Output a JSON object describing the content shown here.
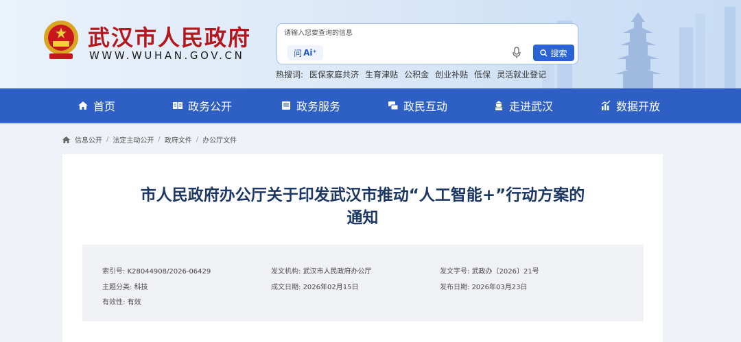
{
  "header": {
    "site_title": "武汉市人民政府",
    "site_url": "WWW.WUHAN.GOV.CN",
    "emblem_icon": "national-emblem-icon",
    "search": {
      "placeholder": "请输入您要查询的信息",
      "ai_label_prefix": "问",
      "ai_label_brand": "Ai⁺",
      "button_label": "搜索"
    },
    "hot_search": {
      "label": "热搜词:",
      "terms": [
        "医保家庭共济",
        "生育津贴",
        "公积金",
        "创业补贴",
        "低保",
        "灵活就业登记"
      ]
    }
  },
  "nav": {
    "items": [
      {
        "label": "首页",
        "icon": "home-icon"
      },
      {
        "label": "政务公开",
        "icon": "open-book-icon"
      },
      {
        "label": "政务服务",
        "icon": "briefcase-icon"
      },
      {
        "label": "政民互动",
        "icon": "chat-icon"
      },
      {
        "label": "走进武汉",
        "icon": "landmark-icon"
      },
      {
        "label": "数据开放",
        "icon": "bar-chart-icon"
      }
    ],
    "accent": "#2e5fc4"
  },
  "breadcrumb": [
    "信息公开",
    "法定主动公开",
    "政府文件",
    "办公厅文件"
  ],
  "document": {
    "title_line1": "市人民政府办公厅关于印发武汉市推动“人工智能+”行动方案的",
    "title_line2": "通知",
    "meta": {
      "index_no_label": "索引号:",
      "index_no": "K28044908/2026-06429",
      "issuer_label": "发文机构:",
      "issuer": "武汉市人民政府办公厅",
      "doc_no_label": "发文字号:",
      "doc_no": "武政办〔2026〕21号",
      "topic_label": "主题分类:",
      "topic": "科技",
      "created_label": "成文日期:",
      "created": "2026年02月15日",
      "published_label": "发布日期:",
      "published": "2026年03月23日",
      "validity_label": "有效性:",
      "validity": "有效"
    }
  }
}
